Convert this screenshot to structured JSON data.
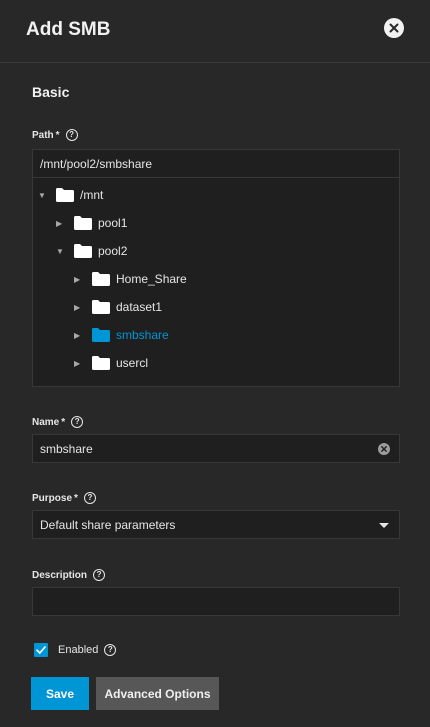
{
  "dialog": {
    "title": "Add SMB"
  },
  "basic": {
    "section_title": "Basic"
  },
  "path": {
    "label": "Path",
    "required_mark": "*",
    "value": "/mnt/pool2/smbshare",
    "tree": [
      {
        "label": "/mnt",
        "expanded": true
      },
      {
        "label": "pool1",
        "expanded": false
      },
      {
        "label": "pool2",
        "expanded": true
      },
      {
        "label": "Home_Share",
        "expanded": false
      },
      {
        "label": "dataset1",
        "expanded": false
      },
      {
        "label": "smbshare",
        "expanded": false,
        "selected": true
      },
      {
        "label": "usercl",
        "expanded": false
      }
    ]
  },
  "name": {
    "label": "Name",
    "required_mark": "*",
    "value": "smbshare"
  },
  "purpose": {
    "label": "Purpose",
    "required_mark": "*",
    "value": "Default share parameters"
  },
  "description": {
    "label": "Description",
    "value": ""
  },
  "enabled": {
    "label": "Enabled",
    "checked": true
  },
  "buttons": {
    "save": "Save",
    "advanced": "Advanced Options"
  },
  "colors": {
    "accent": "#0095d5",
    "background": "#282828",
    "input_bg": "#1f1f1f"
  },
  "help_glyph": "?",
  "icons": {
    "close": "close-circle-icon",
    "help": "help-circle-icon",
    "folder": "folder-icon",
    "clear": "clear-circle-icon",
    "caret": "dropdown-caret-icon",
    "check": "checkmark-icon"
  }
}
